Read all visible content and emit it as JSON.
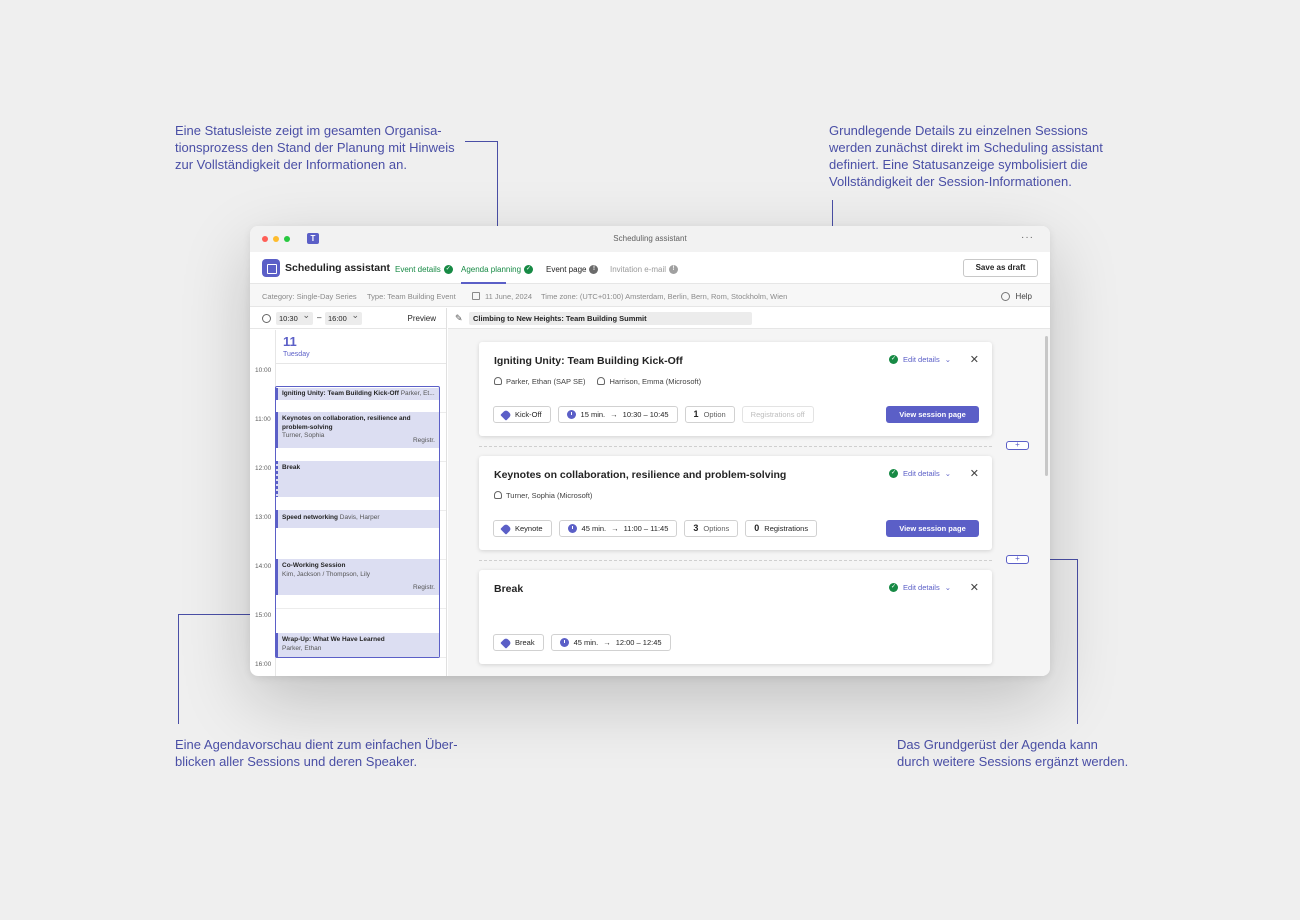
{
  "annotations": {
    "top_left": "Eine Statusleiste zeigt im gesamten Organisa-\ntionsprozess den Stand der Planung mit Hinweis\nzur Vollständigkeit der Informationen an.",
    "top_right": "Grundlegende Details zu einzelnen Sessions\nwerden zunächst direkt im Scheduling assistant\ndefiniert. Eine Statusanzeige symbolisiert die\nVollständigkeit der Session-Informationen.",
    "bottom_left": "Eine Agendavorschau dient zum einfachen Über-\nblicken aller Sessions und deren Speaker.",
    "bottom_right": "Das Grundgerüst der Agenda kann\ndurch weitere Sessions ergänzt werden."
  },
  "window": {
    "title": "Scheduling assistant",
    "more": "···"
  },
  "app": {
    "name": "Scheduling assistant",
    "save_label": "Save as draft"
  },
  "tabs": [
    {
      "label": "Event details",
      "state": "complete"
    },
    {
      "label": "Agenda planning",
      "state": "complete"
    },
    {
      "label": "Event page",
      "state": "info"
    },
    {
      "label": "Invitation e-mail",
      "state": "info"
    }
  ],
  "info": {
    "category": "Category: Single-Day Series",
    "type": "Type: Team Building Event",
    "date": "11 June, 2024",
    "timezone": "Time zone: (UTC+01:00) Amsterdam, Berlin, Bern, Rom, Stockholm, Wien",
    "help": "Help"
  },
  "timebar": {
    "start": "10:30",
    "separator": "–",
    "end": "16:00",
    "preview": "Preview"
  },
  "day": {
    "number": "11",
    "name": "Tuesday"
  },
  "hours": [
    "10:00",
    "11:00",
    "12:00",
    "13:00",
    "14:00",
    "15:00",
    "16:00"
  ],
  "calendar_events": [
    {
      "title": "Igniting Unity: Team Building Kick-Off",
      "inline": "Parker, Et...",
      "sub": "",
      "tag": ""
    },
    {
      "title": "Keynotes on collaboration, resilience and problem-solving",
      "inline": "",
      "sub": "Turner, Sophia",
      "tag": "Registr."
    },
    {
      "title": "Break",
      "inline": "",
      "sub": "",
      "tag": ""
    },
    {
      "title": "Speed networking",
      "inline": "Davis, Harper",
      "sub": "",
      "tag": ""
    },
    {
      "title": "Co-Working Session",
      "inline": "",
      "sub": "Kim, Jackson / Thompson, Lily",
      "tag": "Registr."
    },
    {
      "title": "Wrap-Up: What We Have Learned",
      "inline": "",
      "sub": "Parker, Ethan",
      "tag": ""
    }
  ],
  "event_title": "Climbing to New Heights: Team Building Summit",
  "edit_details_label": "Edit details",
  "view_session_label": "View session page",
  "sessions": [
    {
      "title": "Igniting Unity: Team Building Kick-Off",
      "people": [
        "Parker, Ethan (SAP SE)",
        "Harrison, Emma (Microsoft)"
      ],
      "category": "Kick-Off",
      "duration": "15 min.",
      "time": "10:30 – 10:45",
      "options_count": "1",
      "options_label": "Option",
      "registrations": "Registrations off"
    },
    {
      "title": "Keynotes on collaboration, resilience and problem-solving",
      "people": [
        "Turner, Sophia (Microsoft)"
      ],
      "category": "Keynote",
      "duration": "45 min.",
      "time": "11:00 – 11:45",
      "options_count": "3",
      "options_label": "Options",
      "registrations_count": "0",
      "registrations_label": "Registrations"
    },
    {
      "title": "Break",
      "category": "Break",
      "duration": "45 min.",
      "time": "12:00 – 12:45"
    }
  ],
  "colors": {
    "accent": "#5b5fc7",
    "annotation": "#4a4fa6",
    "success": "#178a45"
  }
}
